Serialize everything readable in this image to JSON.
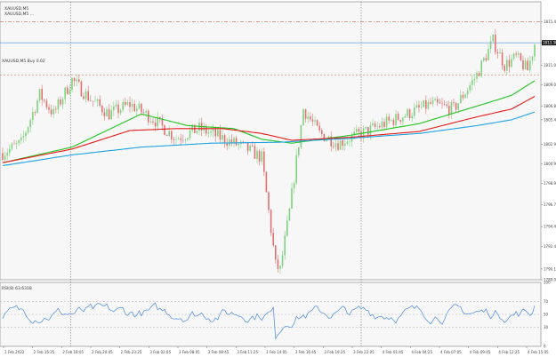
{
  "header": {
    "symbol_label": "XAUUSD,M5",
    "sub_label": "XAUUSD,M5 ...",
    "rsi_label": "RSI(8) 63.6318",
    "level_label": "XAUUSD,M5 Buy 0.02"
  },
  "colors": {
    "bull": "#7fd17f",
    "bear": "#e07070",
    "ma_fast": "#22c322",
    "ma_mid": "#e41a1a",
    "ma_slow": "#1fa2e0",
    "rsi_line": "#4a8ae0",
    "level_line": "#c4643c",
    "ask_line": "#1f78d8",
    "grid_vertical": "#5a5a5a"
  },
  "chart_data": {
    "type": "candlestick",
    "symbol": "XAUUSD",
    "timeframe": "M5",
    "ylim": [
      1789.0,
      1817.5
    ],
    "price_ticks": [
      "1815.45",
      "1813.30",
      "1811.00",
      "1809.00",
      "1806.80",
      "1805.40",
      "1802.90",
      "1800.90",
      "1798.90",
      "1796.70",
      "1794.45",
      "1792.40",
      "1790.10",
      "1789.00"
    ],
    "current_price": "1813.30",
    "ask_price": "1813.30",
    "level_price": "1810.00",
    "top_level_price": "1815.45",
    "time_labels": [
      "1 Feb 2022",
      "2 Feb 15:25",
      "2 Feb 18:05",
      "2 Feb 20:45",
      "2 Feb 23:25",
      "3 Feb 02:05",
      "3 Feb 08:05",
      "3 Feb 08:45",
      "3 Feb 11:25",
      "3 Feb 14:05",
      "3 Feb 16:45",
      "3 Feb 19:25",
      "3 Feb 22:05",
      "4 Feb 01:45",
      "4 Feb 04:25",
      "4 Feb 07:05",
      "4 Feb 09:45",
      "4 Feb 12:25",
      "4 Feb 15:05"
    ],
    "period_separators": [
      2,
      12
    ],
    "close_anchors": [
      [
        0,
        1802.0
      ],
      [
        8,
        1803.0
      ],
      [
        16,
        1808.0
      ],
      [
        22,
        1806.0
      ],
      [
        30,
        1809.5
      ],
      [
        38,
        1807.5
      ],
      [
        46,
        1806.0
      ],
      [
        55,
        1807.0
      ],
      [
        65,
        1805.5
      ],
      [
        75,
        1803.5
      ],
      [
        85,
        1804.5
      ],
      [
        95,
        1803.5
      ],
      [
        105,
        1802.5
      ],
      [
        112,
        1801.5
      ],
      [
        118,
        1790.5
      ],
      [
        120,
        1790.0
      ],
      [
        124,
        1796.0
      ],
      [
        130,
        1806.5
      ],
      [
        137,
        1804.0
      ],
      [
        145,
        1803.0
      ],
      [
        155,
        1804.0
      ],
      [
        165,
        1805.0
      ],
      [
        175,
        1806.0
      ],
      [
        185,
        1807.0
      ],
      [
        195,
        1806.5
      ],
      [
        205,
        1810.0
      ],
      [
        212,
        1813.5
      ],
      [
        217,
        1811.0
      ],
      [
        222,
        1811.8
      ],
      [
        227,
        1810.5
      ],
      [
        230,
        1813.2
      ]
    ],
    "series": [
      {
        "name": "MA fast",
        "values": [
          [
            0,
            1801.0
          ],
          [
            30,
            1802.6
          ],
          [
            60,
            1806.0
          ],
          [
            80,
            1804.8
          ],
          [
            100,
            1804.5
          ],
          [
            112,
            1803.4
          ],
          [
            125,
            1803.0
          ],
          [
            150,
            1803.8
          ],
          [
            180,
            1805.0
          ],
          [
            205,
            1806.8
          ],
          [
            220,
            1807.9
          ],
          [
            230,
            1809.4
          ]
        ]
      },
      {
        "name": "MA mid",
        "values": [
          [
            0,
            1801.0
          ],
          [
            30,
            1802.4
          ],
          [
            55,
            1804.3
          ],
          [
            75,
            1804.5
          ],
          [
            95,
            1804.5
          ],
          [
            112,
            1804.0
          ],
          [
            125,
            1803.3
          ],
          [
            150,
            1803.6
          ],
          [
            180,
            1804.2
          ],
          [
            205,
            1805.7
          ],
          [
            220,
            1806.5
          ],
          [
            230,
            1807.8
          ]
        ]
      },
      {
        "name": "MA slow",
        "values": [
          [
            0,
            1800.7
          ],
          [
            30,
            1801.8
          ],
          [
            60,
            1802.6
          ],
          [
            90,
            1803.0
          ],
          [
            120,
            1803.1
          ],
          [
            150,
            1803.5
          ],
          [
            180,
            1804.0
          ],
          [
            205,
            1804.8
          ],
          [
            220,
            1805.4
          ],
          [
            230,
            1806.2
          ]
        ]
      }
    ],
    "rsi": {
      "ylim": [
        0,
        100
      ],
      "levels": [
        70,
        50,
        30
      ],
      "tick_labels": [
        "100",
        "70",
        "50",
        "30",
        "0"
      ],
      "last_value": 63.6318
    },
    "num_bars": 231
  }
}
